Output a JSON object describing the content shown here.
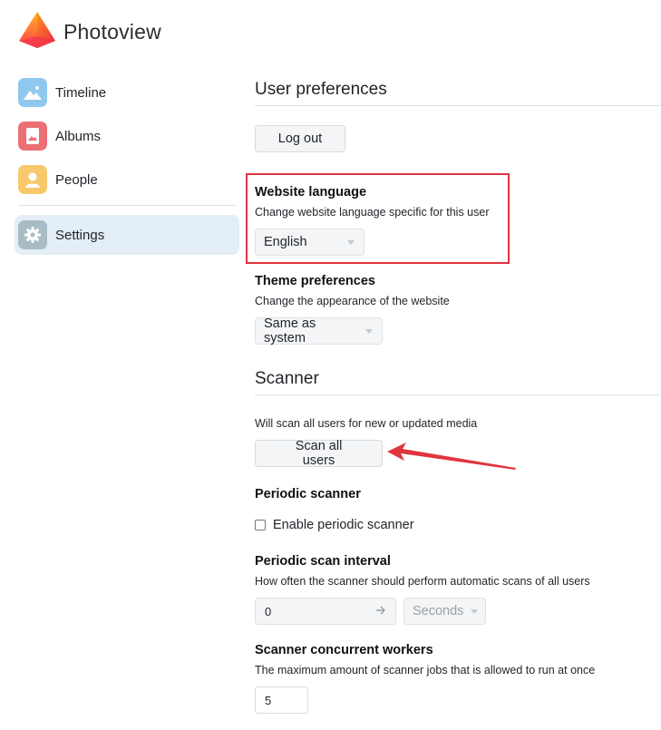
{
  "app": {
    "title": "Photoview"
  },
  "sidebar": {
    "items": [
      {
        "label": "Timeline",
        "icon": "mountain-picture-icon",
        "color": "#8ec8ee"
      },
      {
        "label": "Albums",
        "icon": "album-picture-icon",
        "color": "#ec6f74"
      },
      {
        "label": "People",
        "icon": "person-icon",
        "color": "#f8c96c"
      },
      {
        "label": "Settings",
        "icon": "gear-icon",
        "color": "#a9bcc6",
        "active": true
      }
    ]
  },
  "user_preferences": {
    "title": "User preferences",
    "logout_label": "Log out",
    "language": {
      "title": "Website language",
      "description": "Change website language specific for this user",
      "selected": "English"
    },
    "theme": {
      "title": "Theme preferences",
      "description": "Change the appearance of the website",
      "selected": "Same as system"
    }
  },
  "scanner": {
    "title": "Scanner",
    "description": "Will scan all users for new or updated media",
    "scan_button_label": "Scan all users",
    "periodic": {
      "title": "Periodic scanner",
      "checkbox_label": "Enable periodic scanner",
      "checked": false
    },
    "interval": {
      "title": "Periodic scan interval",
      "description": "How often the scanner should perform automatic scans of all users",
      "value": "0",
      "unit": "Seconds"
    },
    "workers": {
      "title": "Scanner concurrent workers",
      "description": "The maximum amount of scanner jobs that is allowed to run at once",
      "value": "5"
    }
  },
  "annotations": {
    "highlight_color": "#e0343f"
  }
}
